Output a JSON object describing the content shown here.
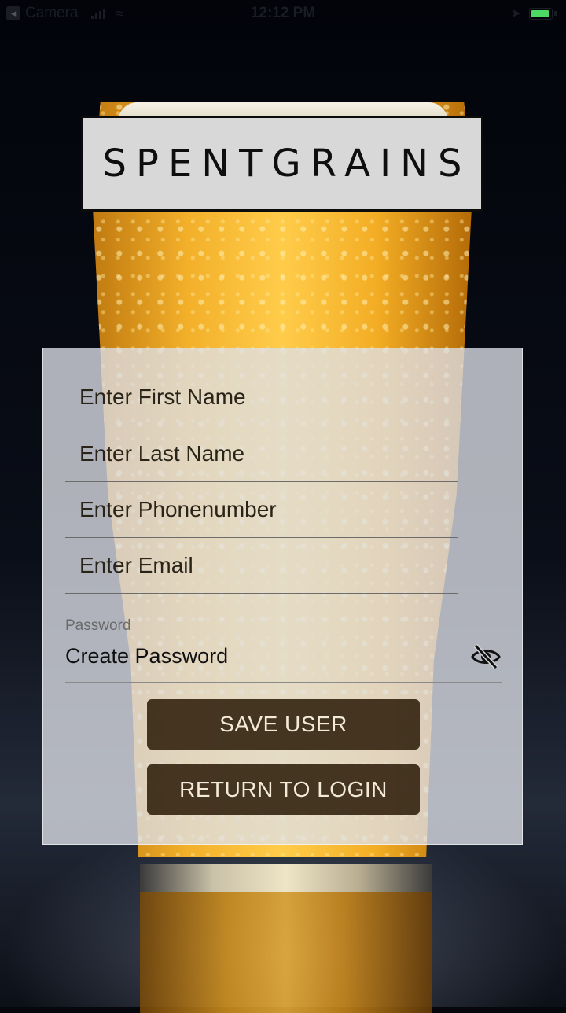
{
  "status_bar": {
    "back_app": "Camera",
    "time": "12:12 PM"
  },
  "logo": {
    "text": "SPENTGRAINS"
  },
  "form": {
    "first_name": {
      "placeholder": "Enter First Name",
      "value": ""
    },
    "last_name": {
      "placeholder": "Enter Last Name",
      "value": ""
    },
    "phone": {
      "placeholder": "Enter Phonenumber",
      "value": ""
    },
    "email": {
      "placeholder": "Enter Email",
      "value": ""
    },
    "password": {
      "label": "Password",
      "placeholder": "Create Password",
      "value": "",
      "visibility_icon": "eye-off-icon"
    }
  },
  "buttons": {
    "save": "SAVE USER",
    "return": "RETURN TO LOGIN"
  },
  "colors": {
    "button_bg": "#2d1e0a",
    "button_text": "#f3ead8",
    "battery": "#4cd964"
  }
}
